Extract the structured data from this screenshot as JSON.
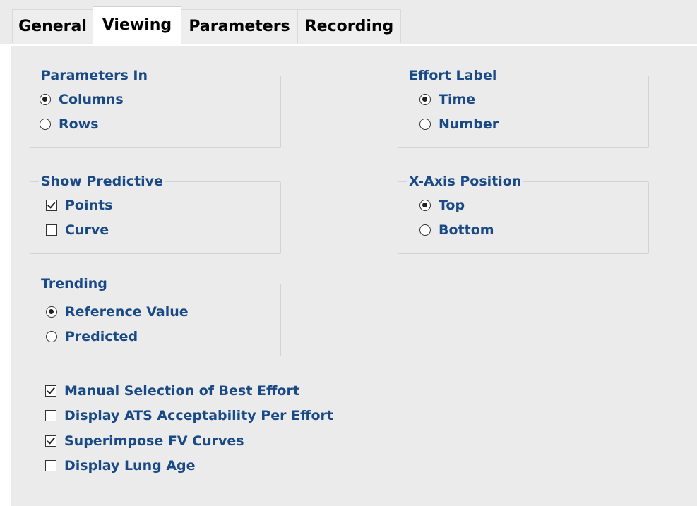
{
  "tabs": {
    "general": "General",
    "viewing": "Viewing",
    "parameters": "Parameters",
    "recording": "Recording",
    "active": "Viewing"
  },
  "colors": {
    "label_blue": "#1a4a86",
    "panel_bg": "#ebebeb"
  },
  "parameters_in": {
    "title": "Parameters In",
    "options": [
      "Columns",
      "Rows"
    ],
    "selected": "Columns"
  },
  "effort_label": {
    "title": "Effort Label",
    "options": [
      "Time",
      "Number"
    ],
    "selected": "Time"
  },
  "show_predictive": {
    "title": "Show Predictive",
    "points": {
      "label": "Points",
      "checked": true
    },
    "curve": {
      "label": "Curve",
      "checked": false
    }
  },
  "x_axis_position": {
    "title": "X-Axis Position",
    "options": [
      "Top",
      "Bottom"
    ],
    "selected": "Top"
  },
  "trending": {
    "title": "Trending",
    "options": [
      "Reference Value",
      "Predicted"
    ],
    "selected": "Reference Value"
  },
  "extras": {
    "manual_selection": {
      "label": "Manual Selection of Best Effort",
      "checked": true
    },
    "display_ats": {
      "label": "Display ATS Acceptability Per Effort",
      "checked": false
    },
    "superimpose_fv": {
      "label": "Superimpose FV Curves",
      "checked": true
    },
    "display_lung_age": {
      "label": "Display Lung Age",
      "checked": false
    }
  }
}
